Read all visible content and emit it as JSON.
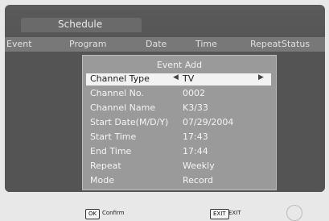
{
  "window": {
    "title": "Schedule"
  },
  "table_headers": [
    "Event",
    "Program",
    "Date",
    "Time",
    "Repeat",
    "Status"
  ],
  "dialog": {
    "title": "Event Add",
    "fields": [
      {
        "label": "Channel Type",
        "value": "TV",
        "selected": true
      },
      {
        "label": "Channel No.",
        "value": "0002"
      },
      {
        "label": "Channel Name",
        "value": "K3/33"
      },
      {
        "label": "Start Date(M/D/Y)",
        "value": "07/29/2004"
      },
      {
        "label": "Start Time",
        "value": "17:43"
      },
      {
        "label": "End Time",
        "value": "17:44"
      },
      {
        "label": "Repeat",
        "value": "Weekly"
      },
      {
        "label": "Mode",
        "value": "Record"
      }
    ]
  },
  "footer": {
    "ok_key": "OK",
    "ok_hint": "Confirm",
    "exit_key": "EXIT",
    "exit_hint": "EXIT"
  },
  "icons": {
    "left_arrow": "left-arrow-icon",
    "right_arrow": "right-arrow-icon",
    "remote": "remote-icon"
  }
}
